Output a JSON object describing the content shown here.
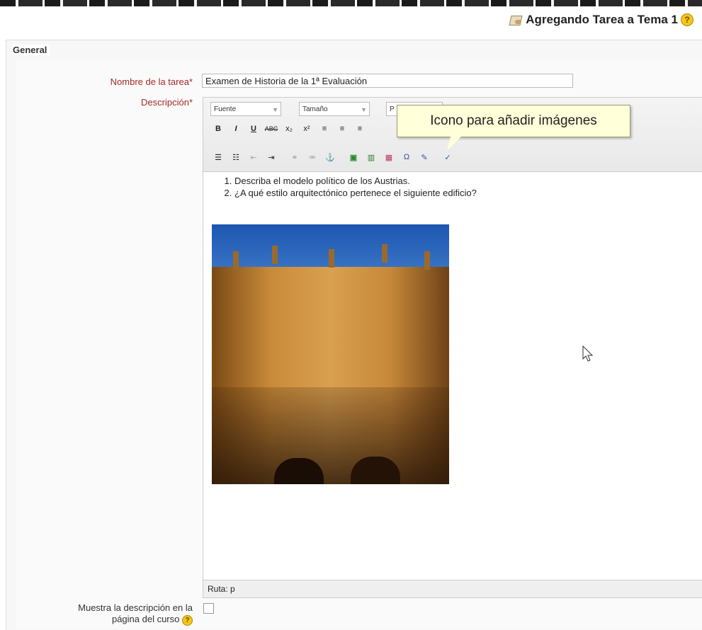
{
  "page": {
    "title": "Agregando Tarea a Tema 1",
    "icon": "assignment-icon",
    "help_icon": "help-icon"
  },
  "section": {
    "legend": "General"
  },
  "form": {
    "name_label": "Nombre de la tarea",
    "name_value": "Examen de Historia de la 1ª Evaluación",
    "desc_label": "Descripción",
    "required_mark": "*",
    "show_desc_label_line1": "Muestra la descripción en la",
    "show_desc_label_line2": "página del curso",
    "show_desc_checked": false
  },
  "editor": {
    "font_select": "Fuente",
    "size_select": "Tamaño",
    "format_select": "P",
    "toolbar_row2": [
      "B",
      "I",
      "U",
      "ABC",
      "x₂",
      "x²",
      "≡",
      "≡",
      "≡"
    ],
    "toolbar_row3_icons": [
      "bullet-list-icon",
      "numbered-list-icon",
      "outdent-icon",
      "indent-icon",
      "link-icon",
      "unlink-icon",
      "anchor-icon",
      "insert-image-icon",
      "moodle-media-icon",
      "embed-icon",
      "special-char-icon",
      "edit-html-icon",
      "spellcheck-icon"
    ],
    "content_list": [
      "Describa el modelo político de los Austrias.",
      "¿A qué estilo arquitectónico pertenece el siguiente edificio?"
    ],
    "path_label": "Ruta: p"
  },
  "tooltip": {
    "text": "Icono para añadir imágenes"
  },
  "colors": {
    "label_required": "#a52a2a",
    "tooltip_bg": "#ffffd9",
    "sky": "#1d56b0"
  }
}
